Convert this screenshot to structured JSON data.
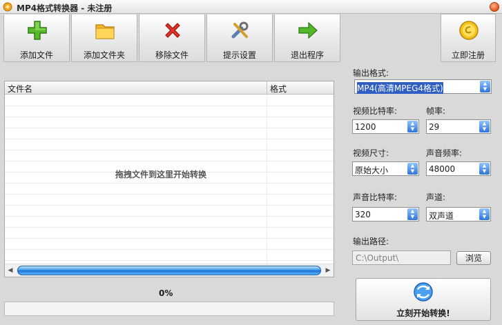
{
  "window": {
    "title": "MP4格式转换器 - 未注册",
    "app_icon": "app-icon",
    "close_icon": "close-icon"
  },
  "toolbar": {
    "items": [
      {
        "label": "添加文件",
        "icon": "add-file-icon"
      },
      {
        "label": "添加文件夹",
        "icon": "folder-icon"
      },
      {
        "label": "移除文件",
        "icon": "remove-icon"
      },
      {
        "label": "提示设置",
        "icon": "settings-tools-icon"
      },
      {
        "label": "退出程序",
        "icon": "exit-arrow-icon"
      }
    ],
    "register": {
      "label": "立即注册",
      "icon": "register-coin-icon"
    }
  },
  "file_list": {
    "columns": [
      "文件名",
      "格式"
    ],
    "rows": [],
    "drop_hint": "拖拽文件到这里开始转换"
  },
  "progress": {
    "text": "0%",
    "value": 0
  },
  "settings": {
    "output_format": {
      "label": "输出格式:",
      "value": "MP4(高清MPEG4格式)"
    },
    "video_bitrate": {
      "label": "视频比特率:",
      "value": "1200"
    },
    "frame_rate": {
      "label": "帧率:",
      "value": "29"
    },
    "video_size": {
      "label": "视频尺寸:",
      "value": "原始大小"
    },
    "audio_rate": {
      "label": "声音频率:",
      "value": "48000"
    },
    "audio_bitrate": {
      "label": "声音比特率:",
      "value": "320"
    },
    "channels": {
      "label": "声道:",
      "value": "双声道"
    },
    "output_path": {
      "label": "输出路径:",
      "value": "C:\\Output\\",
      "browse_label": "浏览"
    }
  },
  "start": {
    "label": "立刻开始转换!",
    "icon": "convert-start-icon"
  },
  "colors": {
    "accent": "#2f74da",
    "progress": "#3d93e5",
    "background": "#d9d9d9"
  }
}
